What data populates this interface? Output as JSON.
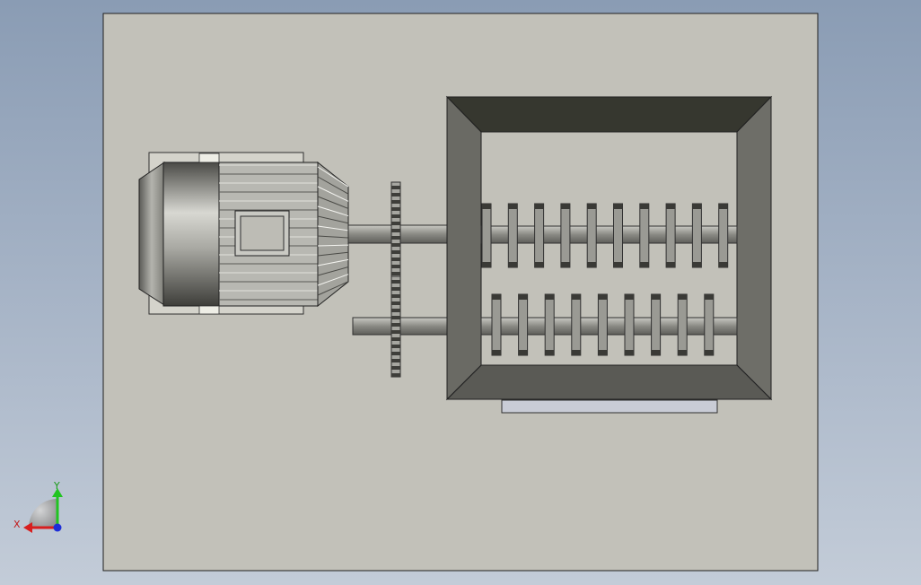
{
  "view": {
    "background_top": "#8a9cb4",
    "background_bottom": "#c3ccd8",
    "base_plate_color": "#c2c1b9"
  },
  "colors": {
    "hopper_dark": "#36372f",
    "hopper_mid": "#5c5c58",
    "hopper_light": "#7a7a74",
    "motor_metal": "#9a9a94",
    "shaft_metal": "#8c8c88",
    "outlet_plate": "#c9ccd6"
  },
  "triad": {
    "x_label": "X",
    "y_label": "Y",
    "x_color": "#d81e1e",
    "y_color": "#21c421",
    "z_color": "#1e2ed8"
  },
  "components": {
    "motor_icon": "electric-motor",
    "sprocket_icon": "chain-sprocket",
    "shredder_icon": "twin-shaft-shredder-hopper"
  }
}
